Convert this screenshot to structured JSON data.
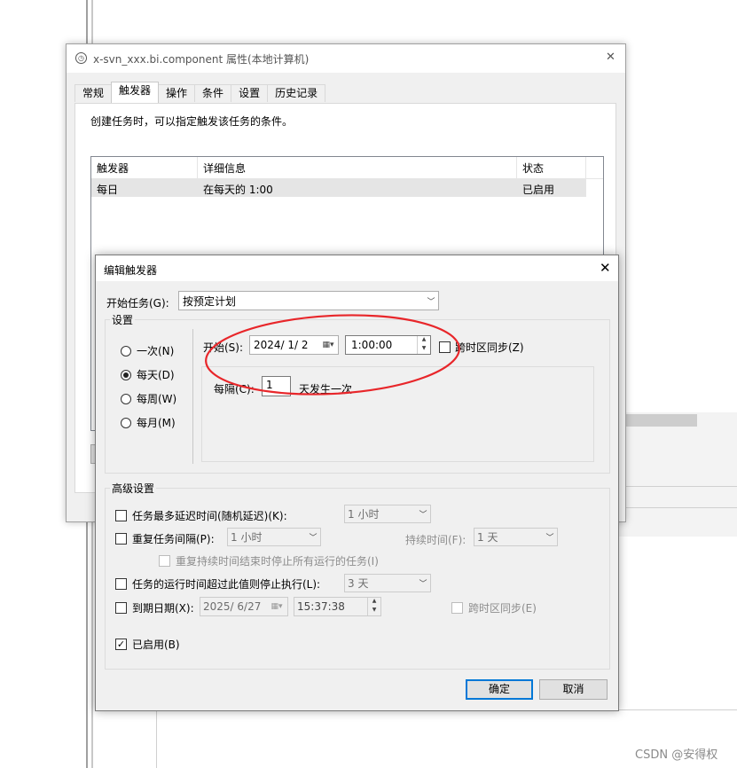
{
  "window": {
    "title": "x-svn_xxx.bi.component 属性(本地计算机)",
    "close_glyph": "✕",
    "tabs": [
      "常规",
      "触发器",
      "操作",
      "条件",
      "设置",
      "历史记录"
    ],
    "description": "创建任务时，可以指定触发该任务的条件。",
    "trigger_list": {
      "columns": [
        "触发器",
        "详细信息",
        "状态"
      ],
      "rows": [
        {
          "trigger": "每日",
          "detail": "在每天的 1:00",
          "status": "已启用"
        }
      ]
    }
  },
  "dialog": {
    "title": "编辑触发器",
    "close_glyph": "✕",
    "begin_task_label": "开始任务(G):",
    "begin_task_value": "按预定计划",
    "settings_legend": "设置",
    "schedule_options": [
      {
        "label": "一次(N)",
        "selected": false
      },
      {
        "label": "每天(D)",
        "selected": true
      },
      {
        "label": "每周(W)",
        "selected": false
      },
      {
        "label": "每月(M)",
        "selected": false
      }
    ],
    "start_label": "开始(S):",
    "start_date": "2024/ 1/ 2",
    "start_time": "1:00:00",
    "sync_timezone_label": "跨时区同步(Z)",
    "recur_label": "每隔(C):",
    "recur_value": "1",
    "recur_suffix": "天发生一次",
    "advanced_legend": "高级设置",
    "advanced": {
      "delay_label": "任务最多延迟时间(随机延迟)(K):",
      "delay_value": "1 小时",
      "repeat_label": "重复任务间隔(P):",
      "repeat_value": "1 小时",
      "duration_label": "持续时间(F):",
      "duration_value": "1 天",
      "stop_repeat_label": "重复持续时间结束时停止所有运行的任务(I)",
      "stop_long_label": "任务的运行时间超过此值则停止执行(L):",
      "stop_long_value": "3 天",
      "expire_label": "到期日期(X):",
      "expire_date": "2025/ 6/27",
      "expire_time": "15:37:38",
      "expire_sync_label": "跨时区同步(E)",
      "enabled_label": "已启用(B)",
      "enabled_checked": true
    },
    "ok_label": "确定",
    "cancel_label": "取消"
  },
  "watermark": "CSDN @安得权",
  "colors": {
    "annotation_red": "#e8262a",
    "focus_blue": "#0078d7"
  }
}
